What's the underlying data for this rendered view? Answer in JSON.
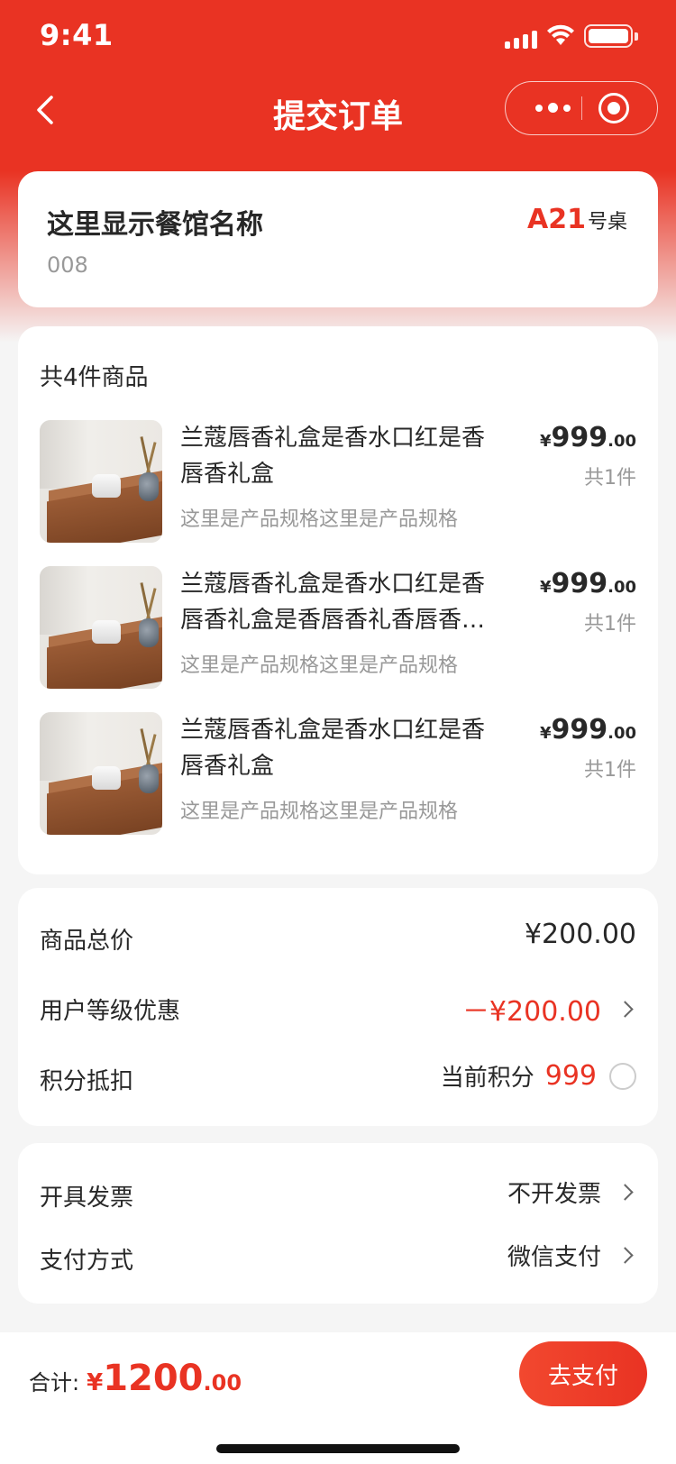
{
  "status_bar": {
    "time": "9:41"
  },
  "nav": {
    "title": "提交订单"
  },
  "restaurant": {
    "name": "这里显示餐馆名称",
    "id": "008",
    "table_number": "A21",
    "table_suffix": "号桌"
  },
  "goods": {
    "count_text": "共4件商品",
    "items": [
      {
        "name": "兰蔻唇香礼盒是香水口红是香唇香礼盒",
        "spec": "这里是产品规格这里是产品规格",
        "price_currency": "¥",
        "price_int": "999",
        "price_dec": ".00",
        "qty": "共1件"
      },
      {
        "name": "兰蔻唇香礼盒是香水口红是香唇香礼盒是香唇香礼香唇香礼盒",
        "spec": "这里是产品规格这里是产品规格",
        "price_currency": "¥",
        "price_int": "999",
        "price_dec": ".00",
        "qty": "共1件"
      },
      {
        "name": "兰蔻唇香礼盒是香水口红是香唇香礼盒",
        "spec": "这里是产品规格这里是产品规格",
        "price_currency": "¥",
        "price_int": "999",
        "price_dec": ".00",
        "qty": "共1件"
      }
    ]
  },
  "summary": {
    "total_label": "商品总价",
    "total_value": "¥200.00",
    "discount_label": "用户等级优惠",
    "discount_value": "－¥200.00",
    "points_label": "积分抵扣",
    "points_current_label": "当前积分",
    "points_value": "999"
  },
  "invoice": {
    "invoice_label": "开具发票",
    "invoice_value": "不开发票",
    "payment_label": "支付方式",
    "payment_value": "微信支付"
  },
  "footer": {
    "total_label": "合计:",
    "currency": "¥",
    "amount_int": "1200",
    "amount_dec": ".00",
    "pay_button": "去支付"
  },
  "colors": {
    "accent": "#e93323",
    "text": "#282828",
    "muted": "#999999",
    "background": "#f5f5f5"
  },
  "icons": [
    "back-chevron-icon",
    "more-dots-icon",
    "close-target-icon",
    "signal-icon",
    "wifi-icon",
    "battery-icon",
    "chevron-right-icon",
    "radio-unchecked-icon"
  ]
}
